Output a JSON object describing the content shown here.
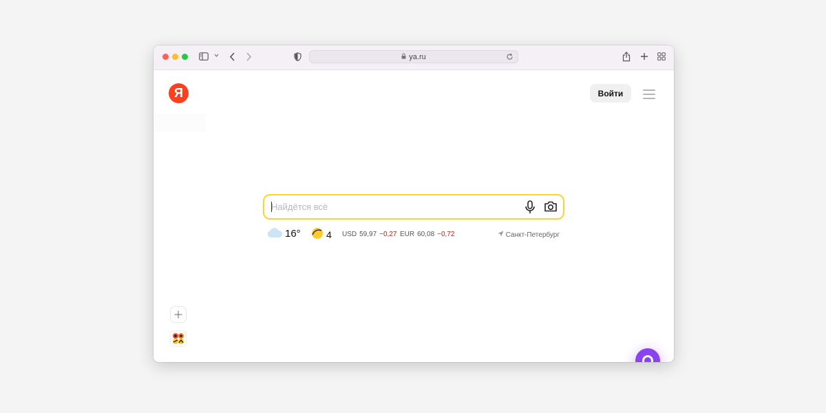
{
  "toolbar": {
    "address_text": "ya.ru"
  },
  "header": {
    "logo_text": "Я",
    "login_label": "Войти"
  },
  "search": {
    "placeholder": "Найдётся всё"
  },
  "informers": {
    "weather_temp": "16°",
    "traffic_score": "4",
    "usd_label": "USD",
    "usd_value": "59,97",
    "usd_change": "−0,27",
    "eur_label": "EUR",
    "eur_value": "60,08",
    "eur_change": "−0,72",
    "city": "Санкт-Петербург"
  },
  "colors": {
    "brand_red": "#fc3f1d",
    "search_border": "#fed42b",
    "alice_purple": "#8b43f0"
  }
}
